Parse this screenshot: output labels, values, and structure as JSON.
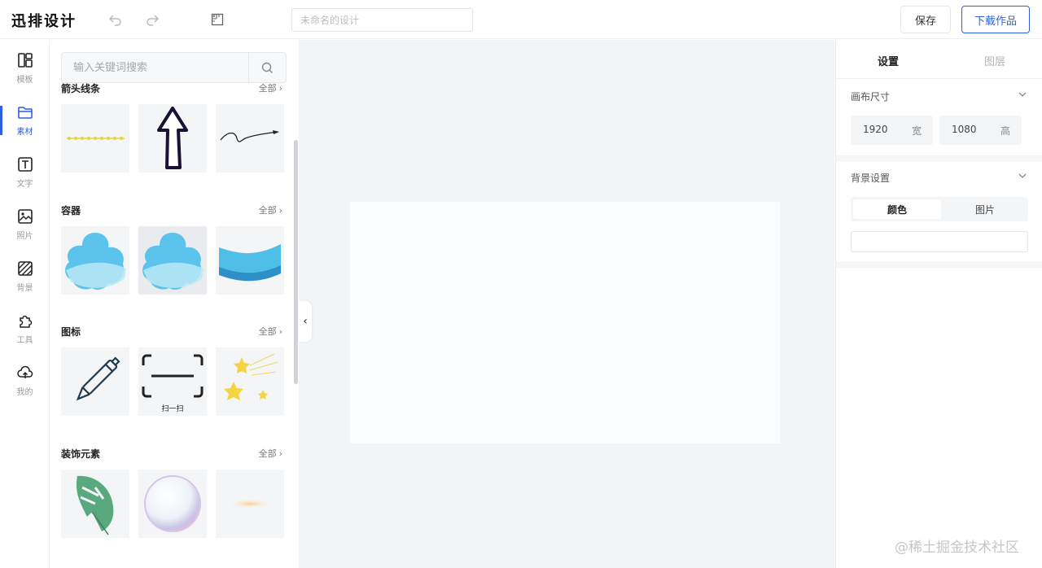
{
  "app": {
    "logo": "迅排设计"
  },
  "header": {
    "title_placeholder": "未命名的设计",
    "save_label": "保存",
    "download_label": "下载作品"
  },
  "nav": {
    "items": [
      {
        "label": "模板",
        "icon": "layout-icon"
      },
      {
        "label": "素材",
        "icon": "folder-icon"
      },
      {
        "label": "文字",
        "icon": "text-icon"
      },
      {
        "label": "照片",
        "icon": "image-icon"
      },
      {
        "label": "背景",
        "icon": "background-icon"
      },
      {
        "label": "工具",
        "icon": "puzzle-icon"
      },
      {
        "label": "我的",
        "icon": "cloud-upload-icon"
      }
    ],
    "active": "素材"
  },
  "materials": {
    "search_placeholder": "输入关键词搜索",
    "all_label": "全部",
    "sections": [
      {
        "title": "箭头线条"
      },
      {
        "title": "容器"
      },
      {
        "title": "图标"
      },
      {
        "title": "装饰元素"
      }
    ],
    "scan_label": "扫一扫"
  },
  "settings": {
    "tab_settings": "设置",
    "tab_layers": "图层",
    "canvas_size_title": "画布尺寸",
    "width_value": "1920",
    "width_unit": "宽",
    "height_value": "1080",
    "height_unit": "高",
    "background_title": "背景设置",
    "bg_color_tab": "颜色",
    "bg_image_tab": "图片"
  },
  "watermark": "@稀土掘金技术社区",
  "colors": {
    "accent": "#2f5fe0",
    "cloud": "#5cc4ec",
    "workspace": "#f3f4f6"
  }
}
